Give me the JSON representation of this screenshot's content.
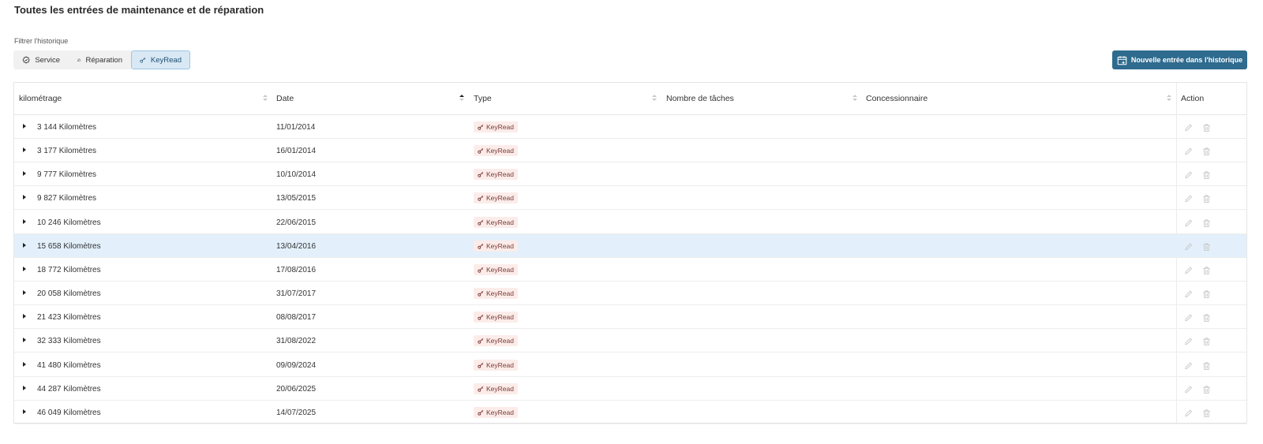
{
  "page": {
    "title": "Toutes les entrées de maintenance et de réparation",
    "filter_label": "Filtrer l'historique"
  },
  "filters": [
    {
      "label": "Service",
      "icon": "gear-check-icon",
      "active": false
    },
    {
      "label": "Réparation",
      "icon": "thumbs-up-icon",
      "active": false
    },
    {
      "label": "KeyRead",
      "icon": "key-icon",
      "active": true
    }
  ],
  "new_entry": {
    "label": "Nouvelle entrée dans l'historique",
    "icon": "calendar-icon"
  },
  "table": {
    "columns": [
      {
        "label": "kilométrage",
        "sort": "none"
      },
      {
        "label": "Date",
        "sort": "asc"
      },
      {
        "label": "Type",
        "sort": "none"
      },
      {
        "label": "Nombre de tâches",
        "sort": "none"
      },
      {
        "label": "Concessionnaire",
        "sort": "none"
      },
      {
        "label": "Action",
        "sort": "none"
      }
    ],
    "rows": [
      {
        "km": "3 144 Kilomètres",
        "date": "11/01/2014",
        "type": "KeyRead",
        "tasks": "",
        "dealer": ""
      },
      {
        "km": "3 177 Kilomètres",
        "date": "16/01/2014",
        "type": "KeyRead",
        "tasks": "",
        "dealer": ""
      },
      {
        "km": "9 777 Kilomètres",
        "date": "10/10/2014",
        "type": "KeyRead",
        "tasks": "",
        "dealer": ""
      },
      {
        "km": "9 827 Kilomètres",
        "date": "13/05/2015",
        "type": "KeyRead",
        "tasks": "",
        "dealer": ""
      },
      {
        "km": "10 246 Kilomètres",
        "date": "22/06/2015",
        "type": "KeyRead",
        "tasks": "",
        "dealer": ""
      },
      {
        "km": "15 658 Kilomètres",
        "date": "13/04/2016",
        "type": "KeyRead",
        "tasks": "",
        "dealer": "",
        "highlighted": true
      },
      {
        "km": "18 772 Kilomètres",
        "date": "17/08/2016",
        "type": "KeyRead",
        "tasks": "",
        "dealer": ""
      },
      {
        "km": "20 058 Kilomètres",
        "date": "31/07/2017",
        "type": "KeyRead",
        "tasks": "",
        "dealer": ""
      },
      {
        "km": "21 423 Kilomètres",
        "date": "08/08/2017",
        "type": "KeyRead",
        "tasks": "",
        "dealer": ""
      },
      {
        "km": "32 333 Kilomètres",
        "date": "31/08/2022",
        "type": "KeyRead",
        "tasks": "",
        "dealer": ""
      },
      {
        "km": "41 480 Kilomètres",
        "date": "09/09/2024",
        "type": "KeyRead",
        "tasks": "",
        "dealer": ""
      },
      {
        "km": "44 287 Kilomètres",
        "date": "20/06/2025",
        "type": "KeyRead",
        "tasks": "",
        "dealer": ""
      },
      {
        "km": "46 049 Kilomètres",
        "date": "14/07/2025",
        "type": "KeyRead",
        "tasks": "",
        "dealer": ""
      }
    ],
    "row_actions": [
      {
        "icon": "pencil-icon",
        "name": "edit"
      },
      {
        "icon": "trash-icon",
        "name": "delete"
      }
    ]
  },
  "colors": {
    "primary": "#2e6b8e",
    "active_filter_bg": "#d8e8f4",
    "highlight_row": "#e3f0fb",
    "badge_bg": "#fbecea",
    "badge_text": "#7a3b34"
  }
}
